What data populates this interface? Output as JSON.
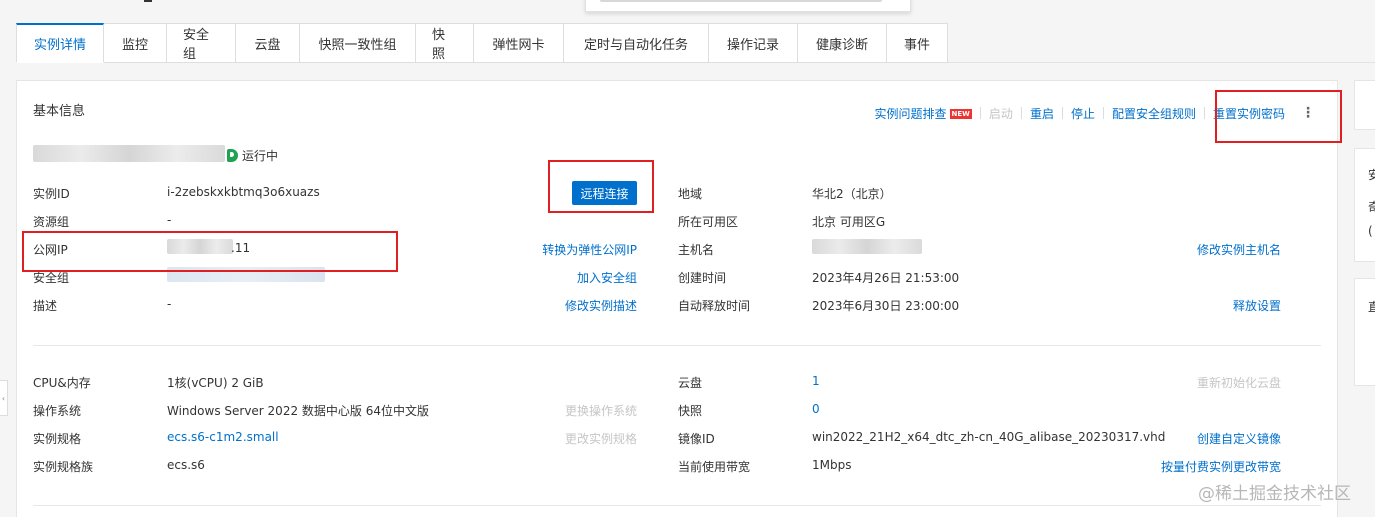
{
  "tabs": [
    "实例详情",
    "监控",
    "安全组",
    "云盘",
    "快照一致性组",
    "快照",
    "弹性网卡",
    "定时与自动化任务",
    "操作记录",
    "健康诊断",
    "事件"
  ],
  "panel_title": "基本信息",
  "actions": {
    "troubleshoot": "实例问题排查",
    "new_badge": "NEW",
    "start": "启动",
    "restart": "重启",
    "stop": "停止",
    "config_sg_rules": "配置安全组规则",
    "reset_password": "重置实例密码",
    "more": "⋮"
  },
  "status": "运行中",
  "remote_connect": "远程连接",
  "basic": {
    "instance_id_label": "实例ID",
    "instance_id": "i-2zebskxkbtmq3o6xuazs",
    "resource_group_label": "资源组",
    "resource_group": "-",
    "public_ip_label": "公网IP",
    "public_ip_suffix": ".11",
    "convert_eip": "转换为弹性公网IP",
    "security_group_label": "安全组",
    "join_sg": "加入安全组",
    "desc_label": "描述",
    "desc": "-",
    "edit_desc": "修改实例描述",
    "region_label": "地域",
    "region": "华北2（北京）",
    "zone_label": "所在可用区",
    "zone": "北京 可用区G",
    "hostname_label": "主机名",
    "edit_hostname": "修改实例主机名",
    "created_label": "创建时间",
    "created": "2023年4月26日 21:53:00",
    "release_label": "自动释放时间",
    "release": "2023年6月30日 23:00:00",
    "release_settings": "释放设置"
  },
  "config": {
    "cpu_mem_label": "CPU&内存",
    "cpu_mem": "1核(vCPU) 2 GiB",
    "os_label": "操作系统",
    "os": "Windows Server 2022 数据中心版 64位中文版",
    "change_os": "更换操作系统",
    "spec_label": "实例规格",
    "spec": "ecs.s6-c1m2.small",
    "change_spec": "更改实例规格",
    "family_label": "实例规格族",
    "family": "ecs.s6",
    "disk_label": "云盘",
    "disk": "1",
    "reinit_disk": "重新初始化云盘",
    "snapshot_label": "快照",
    "snapshot": "0",
    "image_label": "镜像ID",
    "image": "win2022_21H2_x64_dtc_zh-cn_40G_alibase_20230317.vhd",
    "create_image": "创建自定义镜像",
    "bandwidth_label": "当前使用带宽",
    "bandwidth": "1Mbps",
    "change_bandwidth": "按量付费实例更改带宽"
  },
  "side_marks": [
    "安",
    "奇",
    "(",
    "直"
  ],
  "watermark": "@稀土掘金技术社区",
  "colors": {
    "accent": "#0070cc",
    "highlight": "#e02020",
    "running": "#1fa352"
  }
}
